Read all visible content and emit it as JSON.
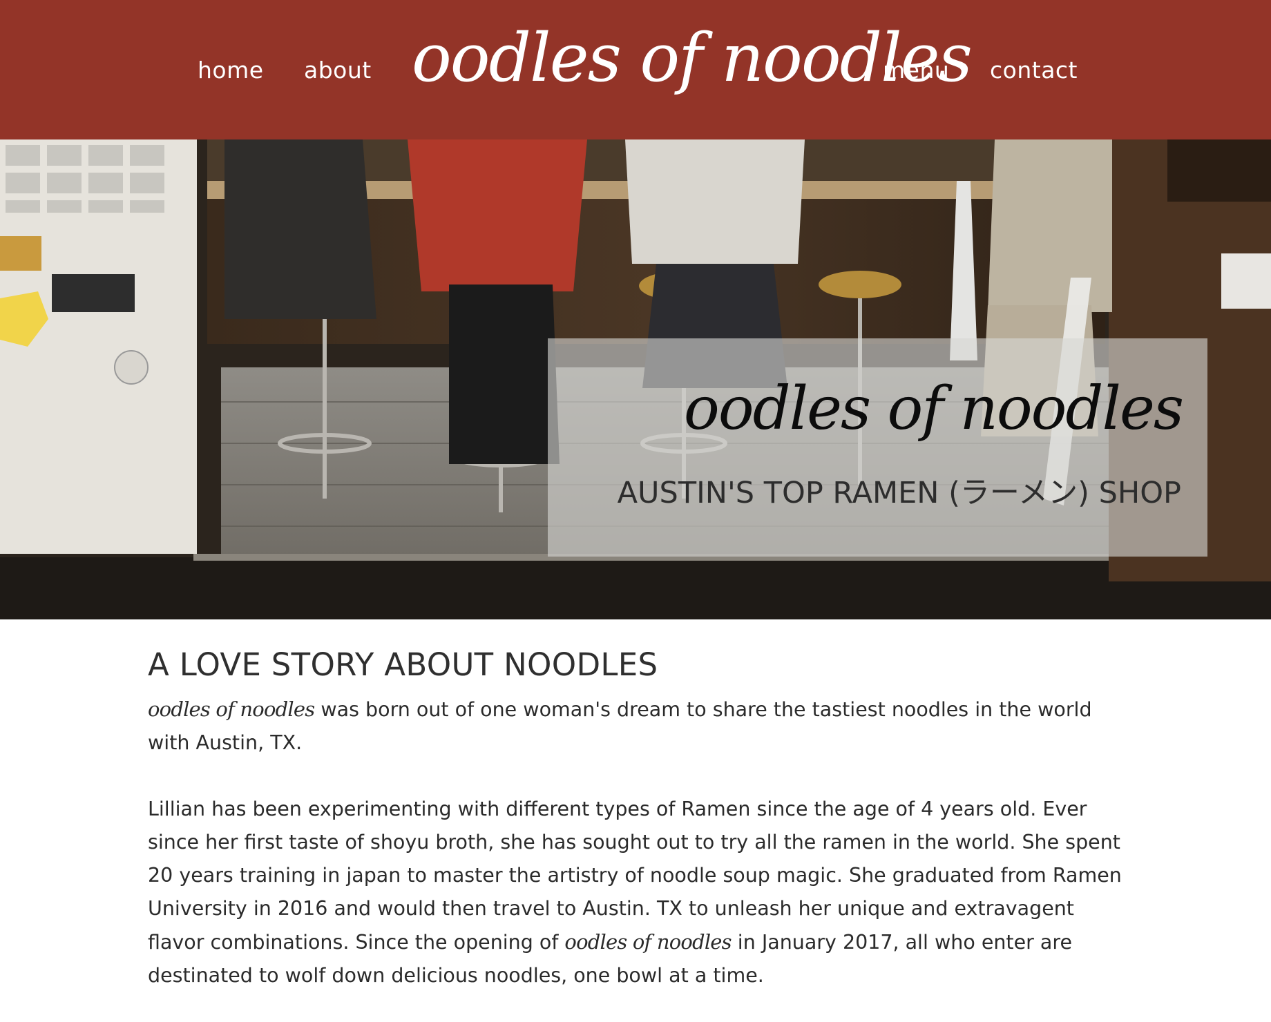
{
  "nav": {
    "home": "home",
    "about": "about",
    "menu": "menu",
    "contact": "contact"
  },
  "logo": "oodles of noodles",
  "hero": {
    "title": "oodles of noodles",
    "subtitle": "AUSTIN'S TOP RAMEN (ラーメン) SHOP",
    "image_description": "customers-seated-at-ramen-counter-photo"
  },
  "story": {
    "title": "A LOVE STORY ABOUT NOODLES",
    "p1_brand": "oodles of noodles",
    "p1_text": " was born out of one woman's dream to share the tastiest noodles in the world with Austin, TX.",
    "p2_text_a": "Lillian has been experimenting with different types of Ramen since the age of 4 years old. Ever since her first taste of shoyu broth, she has sought out to try all the ramen in the world. She spent 20 years training in japan to master the artistry of noodle soup magic. She graduated from Ramen University in 2016 and would then travel to Austin. TX to unleash her unique and extravagent flavor combinations. Since the opening of ",
    "p2_brand": "oodles of noodles",
    "p2_text_b": " in January 2017, all who enter are destinated to wolf down delicious noodles, one bowl at a time."
  },
  "colors": {
    "header_bg": "#933428",
    "nav_text": "#ffffff",
    "body_text": "#2b2b2b"
  }
}
